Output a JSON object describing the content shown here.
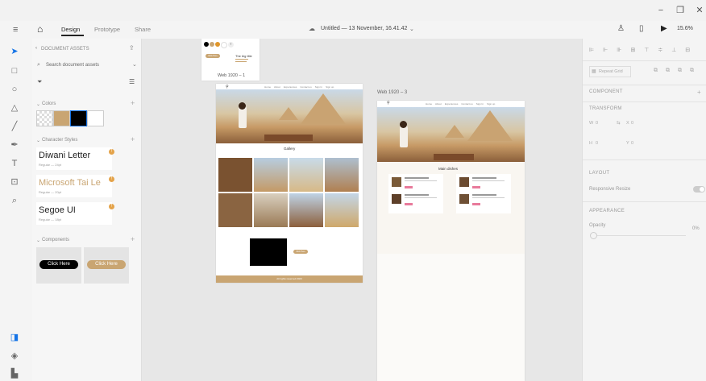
{
  "window": {
    "min": "−",
    "restore": "❐",
    "close": "✕"
  },
  "menu": {
    "tabs": [
      "Design",
      "Prototype",
      "Share"
    ],
    "doc_title": "Untitled — 13 November, 16.41.42",
    "zoom": "15.6%"
  },
  "assets": {
    "header": "DOCUMENT ASSETS",
    "search_placeholder": "Search document assets",
    "colors_label": "Colors",
    "swatches": [
      "#c9a572",
      "#000000",
      "#ffffff"
    ],
    "char_styles_label": "Character Styles",
    "char_styles": [
      {
        "name": "Diwani Letter",
        "meta": "Regular — 24pt",
        "color": "#222222"
      },
      {
        "name": "Microsoft Tai Le",
        "meta": "Regular — 20pt",
        "color": "#c9a572"
      },
      {
        "name": "Segoe UI",
        "meta": "Regular — 18pt",
        "color": "#222222"
      }
    ],
    "components_label": "Components",
    "components": [
      {
        "label": "Click Here",
        "bg": "#000000"
      },
      {
        "label": "Click Here",
        "bg": "#c9a572"
      }
    ]
  },
  "canvas": {
    "small_board": {
      "label": "Web 1920 – 1",
      "title": "The big title",
      "button": "Click Here"
    },
    "board1": {
      "nav": [
        "Home",
        "About",
        "Experiences",
        "Contact us",
        "Sign In",
        "Sign up"
      ],
      "gallery_title": "Gallery",
      "cta": "Click Here",
      "footer": "All rights reserved 2023"
    },
    "board2": {
      "label": "Web 1920 – 3",
      "nav": [
        "Home",
        "About",
        "Experiences",
        "Contact us",
        "Sign In",
        "Sign up"
      ],
      "section_title": "Main dishes"
    }
  },
  "rpanel": {
    "repeat_grid": "Repeat Grid",
    "component": "COMPONENT",
    "transform": "TRANSFORM",
    "w_label": "W",
    "w_val": "0",
    "x_label": "X",
    "x_val": "0",
    "h_label": "H",
    "h_val": "0",
    "y_label": "Y",
    "y_val": "0",
    "layout": "LAYOUT",
    "responsive_resize": "Responsive Resize",
    "appearance": "APPEARANCE",
    "opacity": "Opacity",
    "opacity_val": "0%"
  }
}
